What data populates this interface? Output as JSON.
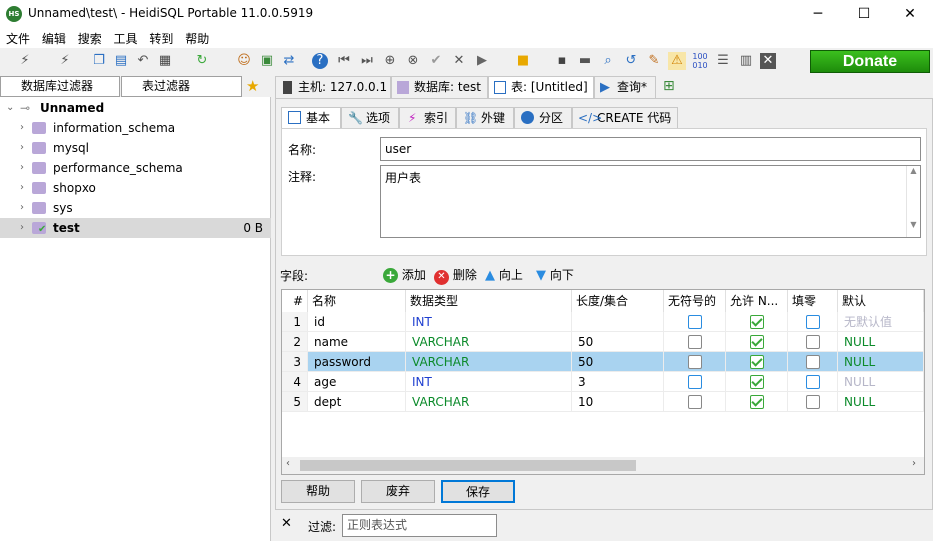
{
  "window": {
    "title": "Unnamed\\test\\ - HeidiSQL Portable 11.0.0.5919",
    "app_icon_text": "HS"
  },
  "window_controls": {
    "minimize": "─",
    "maximize": "☐",
    "close": "✕"
  },
  "menu": [
    "文件",
    "编辑",
    "搜索",
    "工具",
    "转到",
    "帮助"
  ],
  "donate_label": "Donate",
  "filters": {
    "db_filter": "数据库过滤器",
    "table_filter": "表过滤器"
  },
  "tree": {
    "root": "Unnamed",
    "items": [
      {
        "label": "information_schema"
      },
      {
        "label": "mysql"
      },
      {
        "label": "performance_schema"
      },
      {
        "label": "shopxo"
      },
      {
        "label": "sys"
      },
      {
        "label": "test",
        "size": "0 B"
      }
    ]
  },
  "query_tabs": [
    "主机: 127.0.0.1",
    "数据库: test",
    "表: [Untitled]",
    "查询*"
  ],
  "sub_tabs": [
    "基本",
    "选项",
    "索引",
    "外键",
    "分区",
    "CREATE 代码"
  ],
  "form": {
    "name_label": "名称:",
    "name_value": "user",
    "comment_label": "注释:",
    "comment_value": "用户表"
  },
  "fields": {
    "label": "字段:",
    "add": "添加",
    "delete": "删除",
    "up": "向上",
    "down": "向下"
  },
  "grid": {
    "headers": [
      "#",
      "名称",
      "数据类型",
      "长度/集合",
      "无符号的",
      "允许 N...",
      "填零",
      "默认"
    ],
    "rows": [
      {
        "n": "1",
        "name": "id",
        "type": "INT",
        "len": "",
        "unsigned": false,
        "null": true,
        "zero": false,
        "def": "无默认值"
      },
      {
        "n": "2",
        "name": "name",
        "type": "VARCHAR",
        "len": "50",
        "unsigned": false,
        "null": true,
        "zero": false,
        "def": "NULL"
      },
      {
        "n": "3",
        "name": "password",
        "type": "VARCHAR",
        "len": "50",
        "unsigned": false,
        "null": true,
        "zero": false,
        "def": "NULL"
      },
      {
        "n": "4",
        "name": "age",
        "type": "INT",
        "len": "3",
        "unsigned": false,
        "null": true,
        "zero": false,
        "def": "NULL"
      },
      {
        "n": "5",
        "name": "dept",
        "type": "VARCHAR",
        "len": "10",
        "unsigned": false,
        "null": true,
        "zero": false,
        "def": "NULL"
      }
    ]
  },
  "buttons": {
    "help": "帮助",
    "discard": "废弃",
    "save": "保存"
  },
  "filter_bar": {
    "label": "过滤:",
    "placeholder": "正则表达式"
  }
}
